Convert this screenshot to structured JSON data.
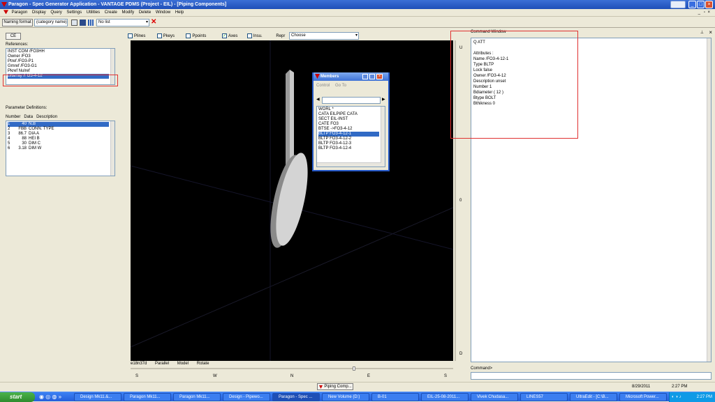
{
  "window": {
    "title": "Paragon - Spec Generator Application - VANTAGE PDMS (Project - EIL) - [Piping Components]"
  },
  "menu": [
    "Paragon",
    "Display",
    "Query",
    "Settings",
    "Utilities",
    "Create",
    "Modify",
    "Delete",
    "Window",
    "Help"
  ],
  "toolbar": {
    "naming_format_label": "Naming format",
    "category_name": "(category name)",
    "list_value": "No list"
  },
  "left": {
    "ce_label": "CE",
    "references_label": "References:",
    "references": [
      "INST COM /FO3HH",
      "Owner /FO3",
      "Ptref /FO3-P1",
      "Gmref /FO3-G1",
      "Pkref Nulref",
      "Bltarray /FO3-4-12"
    ],
    "references_selected": 5,
    "params_label": "Parameter Definitions:",
    "params_header": [
      "Number",
      "Data",
      "Description"
    ],
    "params": [
      {
        "num": "1",
        "data": "40",
        "desc": "N.B"
      },
      {
        "num": "2",
        "data": "FBB",
        "desc": "CONN. TYPE"
      },
      {
        "num": "3",
        "data": "86.7",
        "desc": "DIA A"
      },
      {
        "num": "4",
        "data": "88",
        "desc": "HEI B"
      },
      {
        "num": "5",
        "data": "30",
        "desc": "DIM C"
      },
      {
        "num": "6",
        "data": "3.18",
        "desc": "DIM W"
      }
    ],
    "params_selected": 0
  },
  "viewbar": {
    "plines": "Plines",
    "pkeys": "Pkeys",
    "ppoints": "Ppoints",
    "axes": "Axes",
    "insu": "Insu.",
    "repr_label": "Repr",
    "repr_value": "Choose"
  },
  "view": {
    "status": [
      "e18n37d",
      "Parallel",
      "Model",
      "Rotate"
    ],
    "compass_bottom": [
      "S",
      "W",
      "N",
      "E",
      "S"
    ],
    "compass_right": [
      "U",
      "0",
      "D"
    ]
  },
  "members": {
    "title": "Members",
    "menu": [
      "Control",
      "Go To"
    ],
    "items": [
      "WORL   *",
      "CATA   EILPIPE CATA",
      "SECT   EIL-INST",
      "CATE   FO3",
      "BTSE  ->FO3-4-12",
      "BLTP   FO3-4-12-1",
      "BLTP   FO3-4-12-2",
      "BLTP   FO3-4-12-3",
      "BLTP   FO3-4-12-4"
    ],
    "selected": 5
  },
  "command": {
    "title": "Command Window",
    "output": [
      "Q ATT",
      "",
      "Attributes :",
      "Name /FO3-4-12-1",
      "Type BLTP",
      "Lock false",
      "Owner /FO3-4-12",
      "Description unset",
      "Number 1",
      "Bdiameter ( 12 )",
      "Btype BOLT",
      "Bthikness 0"
    ],
    "prompt_label": "Command>"
  },
  "status": {
    "date": "8/29/2011",
    "time": "2:27 PM",
    "bottom_tab": "Piping Comp..."
  },
  "taskbar": {
    "start": "start",
    "tasks": [
      "Design Mk11.&...",
      "Paragon Mk11...",
      "Paragon Mk11...",
      "Design - Pipewo...",
      "Paragon - Spec ...",
      "New Volume (D:)",
      "B-01",
      "EIL-25-08-2011...",
      "Vivek Chudasa...",
      "LINES57",
      "UltraEdit - [C:\\B...",
      "Microsoft Power..."
    ],
    "active": 4,
    "clock": "2:27 PM"
  }
}
